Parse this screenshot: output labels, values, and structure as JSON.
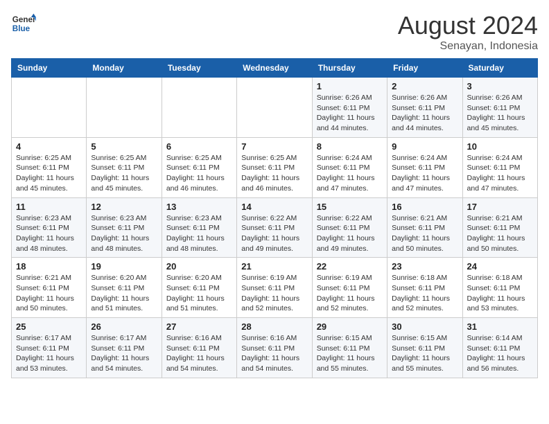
{
  "header": {
    "logo_general": "General",
    "logo_blue": "Blue",
    "month_year": "August 2024",
    "location": "Senayan, Indonesia"
  },
  "weekdays": [
    "Sunday",
    "Monday",
    "Tuesday",
    "Wednesday",
    "Thursday",
    "Friday",
    "Saturday"
  ],
  "weeks": [
    [
      {
        "day": "",
        "info": ""
      },
      {
        "day": "",
        "info": ""
      },
      {
        "day": "",
        "info": ""
      },
      {
        "day": "",
        "info": ""
      },
      {
        "day": "1",
        "info": "Sunrise: 6:26 AM\nSunset: 6:11 PM\nDaylight: 11 hours\nand 44 minutes."
      },
      {
        "day": "2",
        "info": "Sunrise: 6:26 AM\nSunset: 6:11 PM\nDaylight: 11 hours\nand 44 minutes."
      },
      {
        "day": "3",
        "info": "Sunrise: 6:26 AM\nSunset: 6:11 PM\nDaylight: 11 hours\nand 45 minutes."
      }
    ],
    [
      {
        "day": "4",
        "info": "Sunrise: 6:25 AM\nSunset: 6:11 PM\nDaylight: 11 hours\nand 45 minutes."
      },
      {
        "day": "5",
        "info": "Sunrise: 6:25 AM\nSunset: 6:11 PM\nDaylight: 11 hours\nand 45 minutes."
      },
      {
        "day": "6",
        "info": "Sunrise: 6:25 AM\nSunset: 6:11 PM\nDaylight: 11 hours\nand 46 minutes."
      },
      {
        "day": "7",
        "info": "Sunrise: 6:25 AM\nSunset: 6:11 PM\nDaylight: 11 hours\nand 46 minutes."
      },
      {
        "day": "8",
        "info": "Sunrise: 6:24 AM\nSunset: 6:11 PM\nDaylight: 11 hours\nand 47 minutes."
      },
      {
        "day": "9",
        "info": "Sunrise: 6:24 AM\nSunset: 6:11 PM\nDaylight: 11 hours\nand 47 minutes."
      },
      {
        "day": "10",
        "info": "Sunrise: 6:24 AM\nSunset: 6:11 PM\nDaylight: 11 hours\nand 47 minutes."
      }
    ],
    [
      {
        "day": "11",
        "info": "Sunrise: 6:23 AM\nSunset: 6:11 PM\nDaylight: 11 hours\nand 48 minutes."
      },
      {
        "day": "12",
        "info": "Sunrise: 6:23 AM\nSunset: 6:11 PM\nDaylight: 11 hours\nand 48 minutes."
      },
      {
        "day": "13",
        "info": "Sunrise: 6:23 AM\nSunset: 6:11 PM\nDaylight: 11 hours\nand 48 minutes."
      },
      {
        "day": "14",
        "info": "Sunrise: 6:22 AM\nSunset: 6:11 PM\nDaylight: 11 hours\nand 49 minutes."
      },
      {
        "day": "15",
        "info": "Sunrise: 6:22 AM\nSunset: 6:11 PM\nDaylight: 11 hours\nand 49 minutes."
      },
      {
        "day": "16",
        "info": "Sunrise: 6:21 AM\nSunset: 6:11 PM\nDaylight: 11 hours\nand 50 minutes."
      },
      {
        "day": "17",
        "info": "Sunrise: 6:21 AM\nSunset: 6:11 PM\nDaylight: 11 hours\nand 50 minutes."
      }
    ],
    [
      {
        "day": "18",
        "info": "Sunrise: 6:21 AM\nSunset: 6:11 PM\nDaylight: 11 hours\nand 50 minutes."
      },
      {
        "day": "19",
        "info": "Sunrise: 6:20 AM\nSunset: 6:11 PM\nDaylight: 11 hours\nand 51 minutes."
      },
      {
        "day": "20",
        "info": "Sunrise: 6:20 AM\nSunset: 6:11 PM\nDaylight: 11 hours\nand 51 minutes."
      },
      {
        "day": "21",
        "info": "Sunrise: 6:19 AM\nSunset: 6:11 PM\nDaylight: 11 hours\nand 52 minutes."
      },
      {
        "day": "22",
        "info": "Sunrise: 6:19 AM\nSunset: 6:11 PM\nDaylight: 11 hours\nand 52 minutes."
      },
      {
        "day": "23",
        "info": "Sunrise: 6:18 AM\nSunset: 6:11 PM\nDaylight: 11 hours\nand 52 minutes."
      },
      {
        "day": "24",
        "info": "Sunrise: 6:18 AM\nSunset: 6:11 PM\nDaylight: 11 hours\nand 53 minutes."
      }
    ],
    [
      {
        "day": "25",
        "info": "Sunrise: 6:17 AM\nSunset: 6:11 PM\nDaylight: 11 hours\nand 53 minutes."
      },
      {
        "day": "26",
        "info": "Sunrise: 6:17 AM\nSunset: 6:11 PM\nDaylight: 11 hours\nand 54 minutes."
      },
      {
        "day": "27",
        "info": "Sunrise: 6:16 AM\nSunset: 6:11 PM\nDaylight: 11 hours\nand 54 minutes."
      },
      {
        "day": "28",
        "info": "Sunrise: 6:16 AM\nSunset: 6:11 PM\nDaylight: 11 hours\nand 54 minutes."
      },
      {
        "day": "29",
        "info": "Sunrise: 6:15 AM\nSunset: 6:11 PM\nDaylight: 11 hours\nand 55 minutes."
      },
      {
        "day": "30",
        "info": "Sunrise: 6:15 AM\nSunset: 6:11 PM\nDaylight: 11 hours\nand 55 minutes."
      },
      {
        "day": "31",
        "info": "Sunrise: 6:14 AM\nSunset: 6:11 PM\nDaylight: 11 hours\nand 56 minutes."
      }
    ]
  ]
}
